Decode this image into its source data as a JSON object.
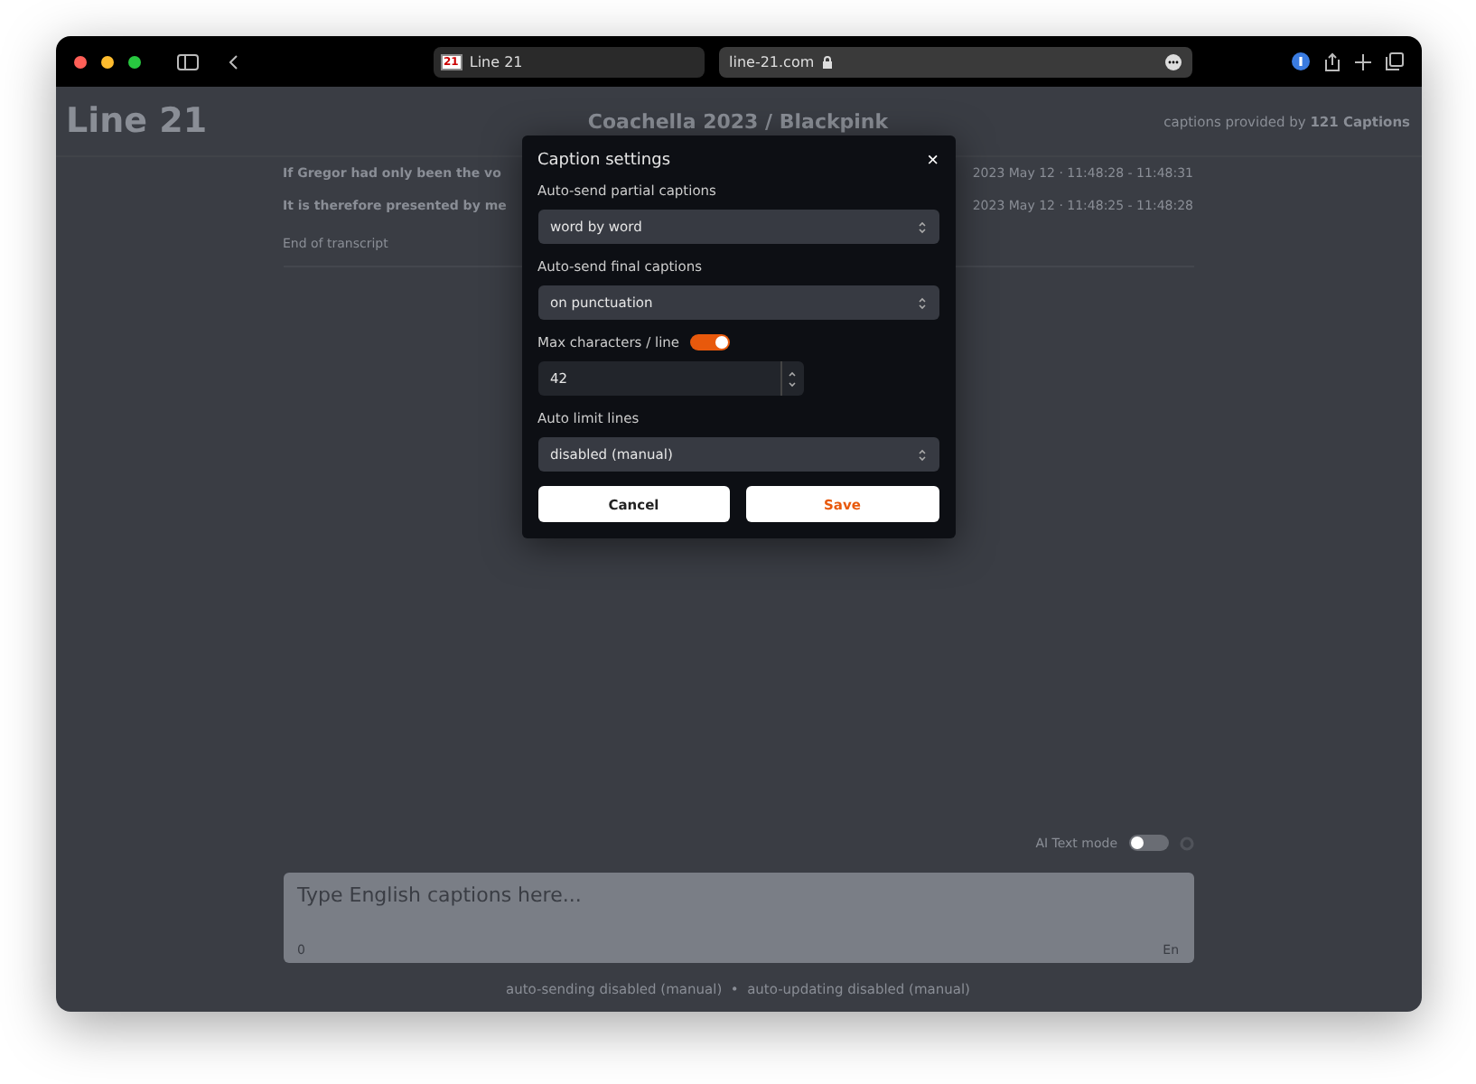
{
  "browser": {
    "tab_title": "Line 21",
    "tab_icon_text": "21",
    "address": "line-21.com"
  },
  "app": {
    "logo": "Line 21",
    "title": "Coachella 2023 / Blackpink",
    "credit": "captions provided by",
    "credit_name": "121 Captions"
  },
  "captions": [
    {
      "text": "If Gregor had only been the vo",
      "time": "2023 May 12 · 11:48:28 - 11:48:31"
    },
    {
      "text": "It is therefore presented by me",
      "time": "2023 May 12 · 11:48:25 - 11:48:28"
    }
  ],
  "transcript_end": "End of transcript",
  "ai_mode": {
    "label": "AI Text mode",
    "on": false
  },
  "editor": {
    "placeholder": "Type English captions here...",
    "count": "0",
    "language": "En"
  },
  "footer": "auto-sending disabled (manual)  •  auto-updating disabled (manual)",
  "dialog": {
    "title": "Caption settings",
    "close": "×",
    "fields": [
      {
        "kind": "select",
        "label": "Auto-send partial captions",
        "value": "word by word"
      },
      {
        "kind": "select",
        "label": "Auto-send final captions",
        "value": "on punctuation"
      },
      {
        "kind": "number",
        "label": "Max characters / line",
        "on": true,
        "value": "42"
      },
      {
        "kind": "select",
        "label": "Auto limit lines",
        "value": "disabled (manual)"
      }
    ],
    "buttons": [
      {
        "label": "Cancel",
        "kind": "secondary"
      },
      {
        "label": "Save",
        "kind": "primary"
      }
    ]
  }
}
